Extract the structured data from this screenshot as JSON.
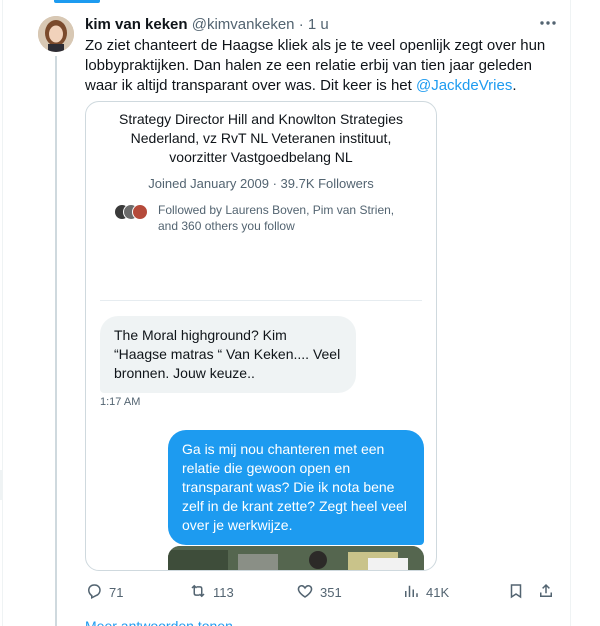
{
  "tweet": {
    "author_name": "kim van keken",
    "author_handle": "@kimvankeken",
    "separator": "·",
    "time": "1 u",
    "text_before_mention": "Zo ziet chanteert de Haagse kliek als je te veel openlijk zegt over hun lobbypraktijken. Dan halen ze een relatie erbij van tien jaar geleden waar ik altijd transparant over was. Dit keer is het ",
    "mention": "@JackdeVries",
    "text_after_mention": "."
  },
  "media": {
    "bio": "Strategy Director Hill and Knowlton Strategies Nederland, vz RvT NL Veteranen instituut, voorzitter Vastgoedbelang NL",
    "joined": "Joined January 2009 · 39.7K Followers",
    "followed_by": "Followed by Laurens Boven, Pim van Strien, and 360 others you follow",
    "message_in": "The Moral highground? Kim “Haagse matras “ Van Keken.... Veel bronnen. Jouw keuze..",
    "message_in_time": "1:17 AM",
    "message_out": "Ga is mij nou chanteren met een relatie die gewoon open en transparant was?  Die ik nota bene zelf in de krant zette? Zegt heel veel over je werkwijze."
  },
  "actions": {
    "replies": "71",
    "reposts": "113",
    "likes": "351",
    "views": "41K"
  },
  "more_replies": "Meer antwoorden tonen",
  "colors": {
    "accent": "#1d9bf0",
    "text_primary": "#0f1419",
    "text_secondary": "#536471"
  },
  "icons": [
    "more-icon",
    "reply-icon",
    "repost-icon",
    "like-icon",
    "views-icon",
    "bookmark-icon",
    "share-icon"
  ]
}
